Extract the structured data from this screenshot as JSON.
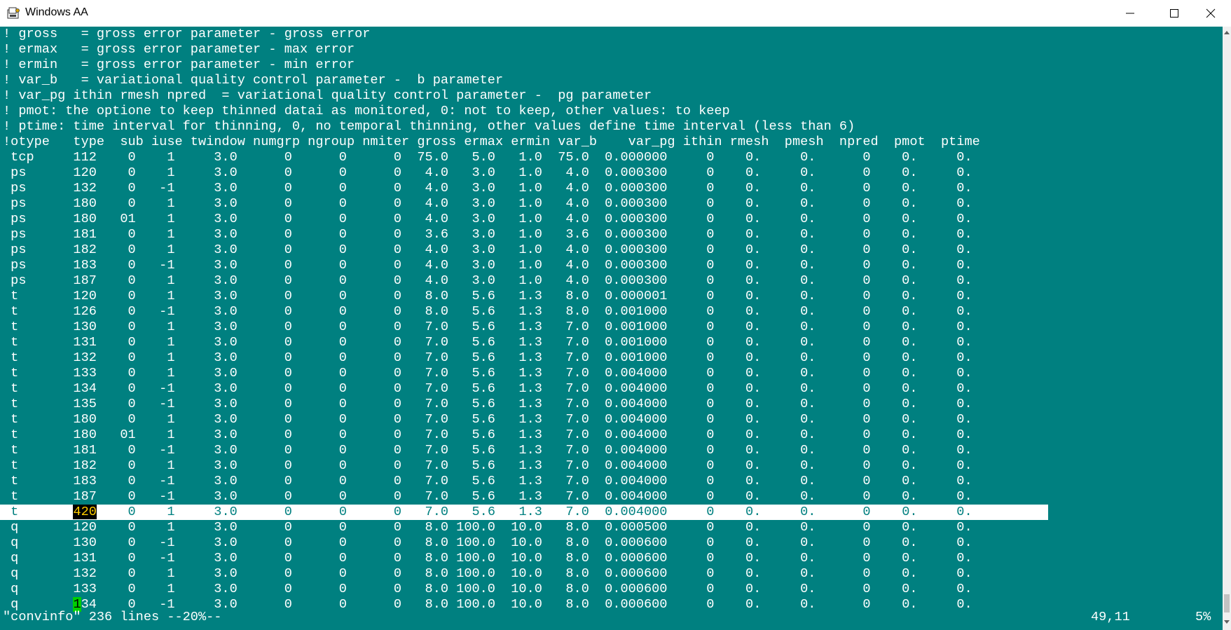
{
  "window": {
    "title": "Windows AA",
    "icons": {
      "app": "terminal-app-icon",
      "minimize": "minimize-icon",
      "maximize": "maximize-icon",
      "close": "close-icon"
    }
  },
  "terminal": {
    "comments": [
      "! gross   = gross error parameter - gross error",
      "! ermax   = gross error parameter - max error",
      "! ermin   = gross error parameter - min error",
      "! var_b   = variational quality control parameter -  b parameter",
      "! var_pg ithin rmesh npred  = variational quality control parameter -  pg parameter",
      "! pmot: the optione to keep thinned datai as monitored, 0: not to keep, other values: to keep",
      "! ptime: time interval for thinning, 0, no temporal thinning, other values define time interval (less than 6)"
    ],
    "header": "!otype   type  sub iuse twindow numgrp ngroup nmiter gross ermax ermin var_b    var_pg ithin rmesh  pmesh  npred  pmot  ptime",
    "rows": [
      " tcp     112    0    1     3.0      0      0      0  75.0   5.0   1.0  75.0  0.000000     0    0.     0.      0    0.     0.",
      " ps      120    0    1     3.0      0      0      0   4.0   3.0   1.0   4.0  0.000300     0    0.     0.      0    0.     0.",
      " ps      132    0   -1     3.0      0      0      0   4.0   3.0   1.0   4.0  0.000300     0    0.     0.      0    0.     0.",
      " ps      180    0    1     3.0      0      0      0   4.0   3.0   1.0   4.0  0.000300     0    0.     0.      0    0.     0.",
      " ps      180   01    1     3.0      0      0      0   4.0   3.0   1.0   4.0  0.000300     0    0.     0.      0    0.     0.",
      " ps      181    0    1     3.0      0      0      0   3.6   3.0   1.0   3.6  0.000300     0    0.     0.      0    0.     0.",
      " ps      182    0    1     3.0      0      0      0   4.0   3.0   1.0   4.0  0.000300     0    0.     0.      0    0.     0.",
      " ps      183    0   -1     3.0      0      0      0   4.0   3.0   1.0   4.0  0.000300     0    0.     0.      0    0.     0.",
      " ps      187    0    1     3.0      0      0      0   4.0   3.0   1.0   4.0  0.000300     0    0.     0.      0    0.     0.",
      " t       120    0    1     3.0      0      0      0   8.0   5.6   1.3   8.0  0.000001     0    0.     0.      0    0.     0.",
      " t       126    0   -1     3.0      0      0      0   8.0   5.6   1.3   8.0  0.001000     0    0.     0.      0    0.     0.",
      " t       130    0    1     3.0      0      0      0   7.0   5.6   1.3   7.0  0.001000     0    0.     0.      0    0.     0.",
      " t       131    0    1     3.0      0      0      0   7.0   5.6   1.3   7.0  0.001000     0    0.     0.      0    0.     0.",
      " t       132    0    1     3.0      0      0      0   7.0   5.6   1.3   7.0  0.001000     0    0.     0.      0    0.     0.",
      " t       133    0    1     3.0      0      0      0   7.0   5.6   1.3   7.0  0.004000     0    0.     0.      0    0.     0.",
      " t       134    0   -1     3.0      0      0      0   7.0   5.6   1.3   7.0  0.004000     0    0.     0.      0    0.     0.",
      " t       135    0   -1     3.0      0      0      0   7.0   5.6   1.3   7.0  0.004000     0    0.     0.      0    0.     0.",
      " t       180    0    1     3.0      0      0      0   7.0   5.6   1.3   7.0  0.004000     0    0.     0.      0    0.     0.",
      " t       180   01    1     3.0      0      0      0   7.0   5.6   1.3   7.0  0.004000     0    0.     0.      0    0.     0.",
      " t       181    0   -1     3.0      0      0      0   7.0   5.6   1.3   7.0  0.004000     0    0.     0.      0    0.     0.",
      " t       182    0    1     3.0      0      0      0   7.0   5.6   1.3   7.0  0.004000     0    0.     0.      0    0.     0.",
      " t       183    0   -1     3.0      0      0      0   7.0   5.6   1.3   7.0  0.004000     0    0.     0.      0    0.     0.",
      " t       187    0   -1     3.0      0      0      0   7.0   5.6   1.3   7.0  0.004000     0    0.     0.      0    0.     0."
    ],
    "highlight_row": {
      "prefix": " t       ",
      "cursor_text": "420",
      "suffix": "    0    1     3.0      0      0      0   7.0   5.6   1.3   7.0  0.004000     0    0.     0.      0    0.     0."
    },
    "rows_after": [
      " q       120    0    1     3.0      0      0      0   8.0 100.0  10.0   8.0  0.000500     0    0.     0.      0    0.     0.",
      " q       130    0   -1     3.0      0      0      0   8.0 100.0  10.0   8.0  0.000600     0    0.     0.      0    0.     0.",
      " q       131    0   -1     3.0      0      0      0   8.0 100.0  10.0   8.0  0.000600     0    0.     0.      0    0.     0.",
      " q       132    0    1     3.0      0      0      0   8.0 100.0  10.0   8.0  0.000600     0    0.     0.      0    0.     0.",
      " q       133    0    1     3.0      0      0      0   8.0 100.0  10.0   8.0  0.000600     0    0.     0.      0    0.     0."
    ],
    "last_row": {
      "prefix": " q       ",
      "cursor_char": "1",
      "suffix": "34    0   -1     3.0      0      0      0   8.0 100.0  10.0   8.0  0.000600     0    0.     0.      0    0.     0."
    }
  },
  "statusbar": {
    "file_info": "\"convinfo\" 236 lines --20%--",
    "cursor_pos": "49,11",
    "percent": "5%"
  },
  "colors": {
    "terminal_bg": "#008080",
    "text": "#ffffff",
    "highlight_row_bg": "#ffffff",
    "cursor_bg": "#000000",
    "cursor_fg": "#ffcc00",
    "cursor2_bg": "#00d000"
  }
}
